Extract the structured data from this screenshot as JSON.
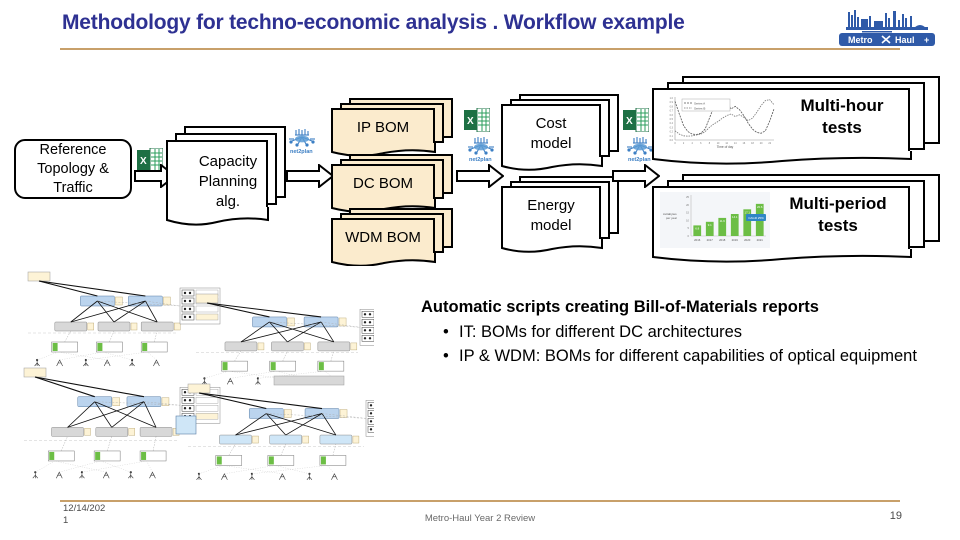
{
  "slide": {
    "title": "Methodology for techno-economic analysis . Workflow example",
    "title_color": "#2E3192",
    "rule_color": "#C8A06A",
    "background": "#FFFFFF"
  },
  "logo": {
    "name": "metro-haul-logo",
    "text_left": "Metro",
    "text_right": "Haul",
    "color": "#2F5AA8"
  },
  "workflow": {
    "input": {
      "label_line1": "Reference",
      "label_line2": "Topology &",
      "label_line3": "Traffic"
    },
    "algorithm": {
      "label_line1": "Capacity",
      "label_line2": "Planning",
      "label_line3": "alg."
    },
    "boms": [
      {
        "label": "IP BOM",
        "fill": "#FBEBCD"
      },
      {
        "label": "DC BOM",
        "fill": "#FBEBCD"
      },
      {
        "label": "WDM BOM",
        "fill": "#FBEBCD"
      }
    ],
    "models": [
      {
        "label_line1": "Cost",
        "label_line2": "model"
      },
      {
        "label_line1": "Energy",
        "label_line2": "model"
      }
    ],
    "tests": [
      {
        "label_line1": "Multi-hour",
        "label_line2": "tests"
      },
      {
        "label_line1": "Multi-period",
        "label_line2": "tests"
      }
    ],
    "icons": {
      "excel": "excel-icon",
      "net2plan": "net2plan-icon",
      "net2plan_label": "net2plan",
      "excel_letter": "X",
      "arrow": "right-arrow-icon"
    }
  },
  "chart_data": [
    {
      "type": "line",
      "title": "",
      "xlabel": "Time of day",
      "ylabel": "",
      "x": [
        0,
        1,
        2,
        3,
        4,
        5,
        6,
        7,
        8,
        9,
        10,
        11,
        12,
        13,
        14,
        15,
        16,
        17,
        18,
        19,
        20,
        21,
        22,
        23
      ],
      "ylim": [
        0,
        1
      ],
      "grid": false,
      "legend": "top-left",
      "series": [
        {
          "name": "Series A",
          "values": [
            0.92,
            0.62,
            0.34,
            0.2,
            0.14,
            0.13,
            0.16,
            0.26,
            0.52,
            0.78,
            0.92,
            0.96,
            0.9,
            0.74,
            0.8,
            0.72,
            0.58,
            0.4,
            0.26,
            0.18,
            0.16,
            0.22,
            0.45,
            0.74
          ]
        },
        {
          "name": "Series B",
          "values": [
            0.22,
            0.14,
            0.1,
            0.09,
            0.1,
            0.12,
            0.14,
            0.2,
            0.3,
            0.38,
            0.44,
            0.52,
            0.58,
            0.62,
            0.56,
            0.6,
            0.54,
            0.46,
            0.52,
            0.66,
            0.82,
            0.94,
            0.96,
            0.84
          ]
        }
      ]
    },
    {
      "type": "bar",
      "title": "",
      "xlabel": "",
      "ylabel": "zettabytes per year",
      "categories": [
        "2016",
        "2017",
        "2018",
        "2019",
        "2020",
        "2021"
      ],
      "values": [
        6.8,
        9.1,
        11.6,
        14.1,
        17.1,
        20.6
      ],
      "ylim": [
        0,
        25
      ],
      "bar_color": "#6CBE45",
      "grid": false,
      "annotation": "CAGR 25%"
    }
  ],
  "summary": {
    "heading": "Automatic scripts creating Bill-of-Materials reports",
    "bullets": [
      "IT: BOMs for different DC architectures",
      "IP & WDM: BOMs for different capabilities of optical equipment"
    ]
  },
  "network_picture": {
    "name": "network-topology-diagram"
  },
  "footer": {
    "date_line1": "12/14/202",
    "date_line2": "1",
    "center": "Metro-Haul Year 2 Review",
    "page": "19"
  }
}
